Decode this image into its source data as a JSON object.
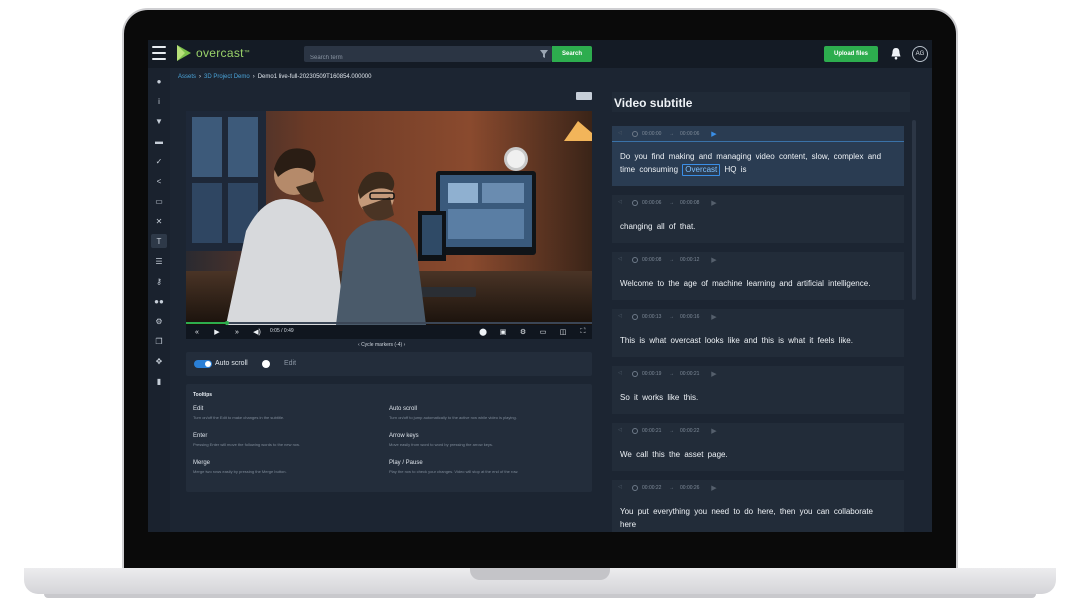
{
  "topbar": {
    "brand": "overcast",
    "brand_tm": "™",
    "search_placeholder": "Search term",
    "search_label": "Search",
    "upload_label": "Upload files",
    "avatar_initials": "AG"
  },
  "breadcrumb": {
    "items": [
      "Assets",
      "3D Project Demo",
      "Demo1 live-full-20230509T160854.000000"
    ]
  },
  "player": {
    "current_time": "0:05",
    "separator": "/",
    "duration": "0:49",
    "progress": 0.1,
    "cycle_label": "Cycle markers",
    "cycle_count": "(-4)"
  },
  "toggles": {
    "autoscroll_label": "Auto scroll",
    "edit_label": "Edit"
  },
  "tooltips": {
    "title": "Tooltips",
    "items": [
      {
        "title": "Edit",
        "desc": "Turn on/off the Edit to make changes in the subtitle."
      },
      {
        "title": "Auto scroll",
        "desc": "Turn on/off to jump automatically to the active row while video is playing."
      },
      {
        "title": "Enter",
        "desc": "Pressing Enter will move the following words to the new row."
      },
      {
        "title": "Arrow keys",
        "desc": "Move easily from word to word by pressing the arrow keys."
      },
      {
        "title": "Merge",
        "desc": "Merge two rows easily by pressing the Merge button."
      },
      {
        "title": "Play / Pause",
        "desc": "Play the row to check your changes. Video will stop at the end of the row."
      }
    ]
  },
  "subtitle_panel": {
    "title": "Video subtitle",
    "arrow": "→",
    "segments": [
      {
        "start": "00:00:00",
        "end": "00:00:06",
        "text_before": "Do you find making and managing video content, slow, complex and time consuming",
        "keyword": "Overcast",
        "text_after": "HQ is"
      },
      {
        "start": "00:00:06",
        "end": "00:00:08",
        "text": "changing all of that."
      },
      {
        "start": "00:00:08",
        "end": "00:00:12",
        "text": "Welcome to the age of machine learning and artificial intelligence."
      },
      {
        "start": "00:00:13",
        "end": "00:00:16",
        "text": "This is what overcast looks like and this is what it feels like."
      },
      {
        "start": "00:00:19",
        "end": "00:00:21",
        "text": "So it works like this."
      },
      {
        "start": "00:00:21",
        "end": "00:00:22",
        "text": "We call this the asset page."
      },
      {
        "start": "00:00:22",
        "end": "00:00:26",
        "text": "You put everything you need to do here, then you can collaborate here"
      }
    ]
  },
  "colors": {
    "accent_green": "#2dad4e",
    "accent_blue": "#3a8ee6",
    "screen_bg": "#1c2532"
  }
}
